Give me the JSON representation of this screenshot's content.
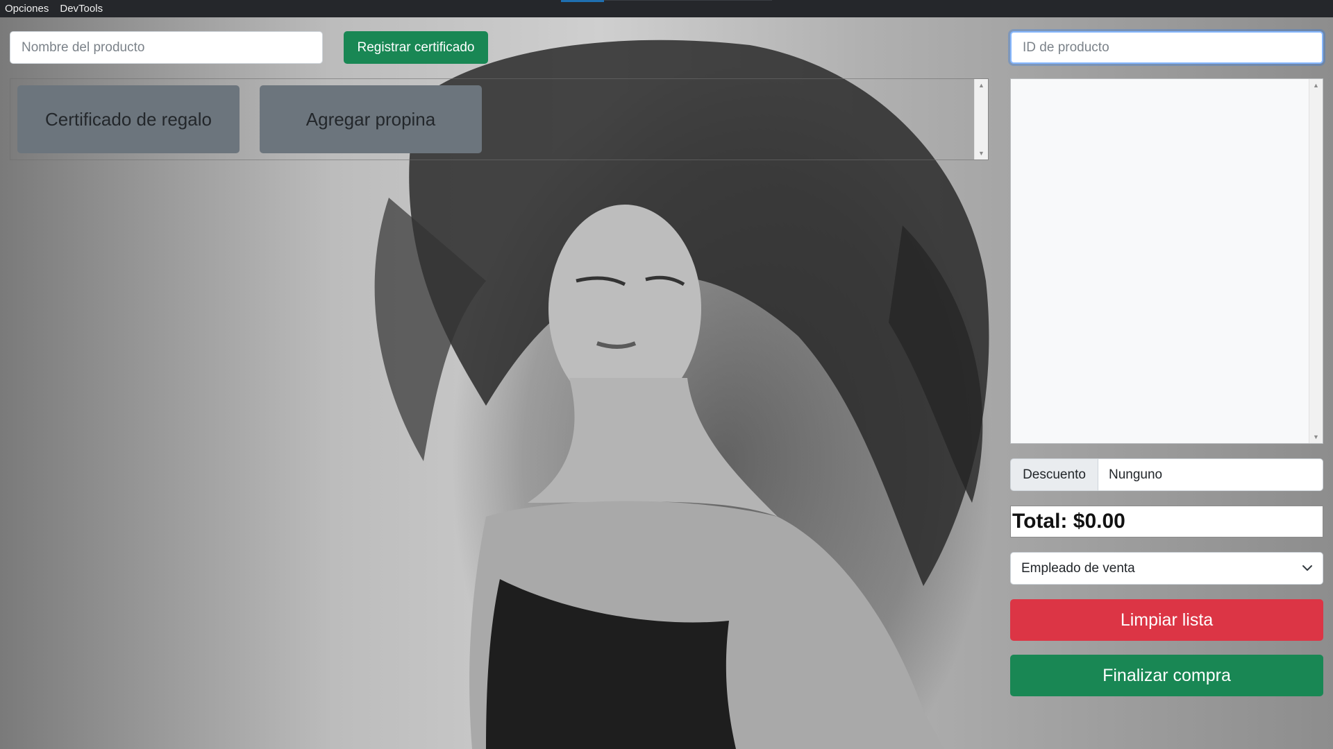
{
  "menubar": {
    "items": [
      "Opciones",
      "DevTools"
    ]
  },
  "left_panel": {
    "product_name_placeholder": "Nombre del producto",
    "register_button": "Registrar certificado",
    "tiles": [
      "Certificado de regalo",
      "Agregar propina"
    ]
  },
  "right_panel": {
    "product_id_placeholder": "ID de producto",
    "discount_label": "Descuento",
    "discount_value": "Nunguno",
    "total_text": "Total: $0.00",
    "employee_select": "Empleado de venta",
    "clear_button": "Limpiar lista",
    "checkout_button": "Finalizar compra"
  },
  "colors": {
    "green": "#198754",
    "red": "#dc3545",
    "tile_gray": "#6c757d",
    "menubar": "#25272b"
  },
  "icons": {
    "select_arrow": "chevron-down-icon",
    "scroll_up": "scroll-up-arrow-icon",
    "scroll_down": "scroll-down-arrow-icon"
  }
}
